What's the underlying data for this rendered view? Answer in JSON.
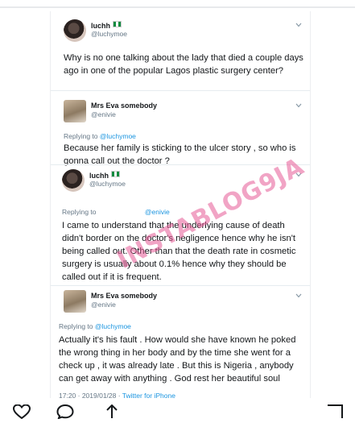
{
  "tweets": [
    {
      "name": "luchh",
      "handle": "@luchymoe",
      "text": "Why is no one talking about the lady that died a couple days ago in one of the popular Lagos plastic surgery center?"
    },
    {
      "name": "Mrs Eva somebody",
      "handle": "@enivie",
      "replying_to_label": "Replying to",
      "replying_to": "@luchymoe",
      "text": "Because her family is sticking to the ulcer story , so who is gonna call out the doctor ?"
    },
    {
      "name": "luchh",
      "handle": "@luchymoe",
      "replying_to_label": "Replying to",
      "replying_to": "@enivie",
      "text": "I came to understand that the underlying cause of death didn't border on the doctor's negligence hence why he isn't being called out. Other than that the death rate in cosmetic surgery is usually about 0.1% hence why they should be called out if it is frequent."
    },
    {
      "name": "Mrs Eva somebody",
      "handle": "@enivie",
      "replying_to_label": "Replying to",
      "replying_to": "@luchymoe",
      "text": "Actually it's his fault . How would she have known he poked the wrong thing in her body and by the time she went for a check up , it was already late . But this is Nigeria , anybody can get away with anything . God rest her beautiful soul",
      "timestamp": "17:20 · 2019/01/28 ·",
      "source": "Twitter for iPhone"
    }
  ],
  "watermark": "INSTABLOG9JA",
  "icons": [
    "chevron-down-icon",
    "heart-icon",
    "comment-icon",
    "share-icon",
    "bookmark-icon"
  ]
}
